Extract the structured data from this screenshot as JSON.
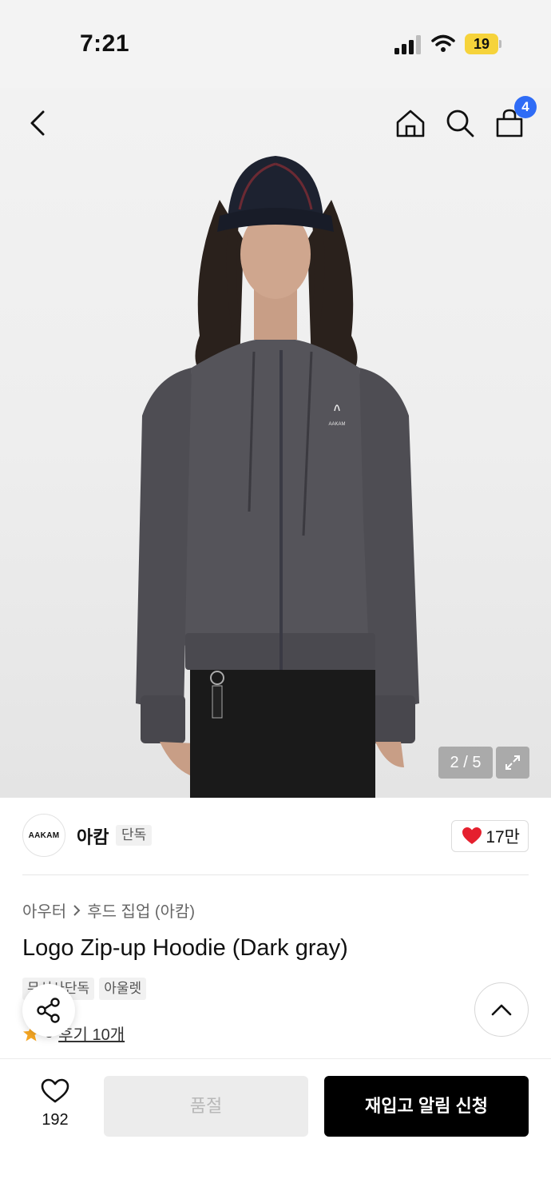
{
  "status_bar": {
    "time": "7:21",
    "battery": "19",
    "icons": [
      "cellular-signal-icon",
      "wifi-icon",
      "battery-icon"
    ]
  },
  "nav": {
    "icons": [
      "back-icon",
      "home-icon",
      "search-icon",
      "cart-icon"
    ],
    "cart_count": "4"
  },
  "gallery": {
    "counter": "2 / 5",
    "garment_logo": "AAKAM",
    "expand_icon": "expand-icon"
  },
  "brand": {
    "logo_text": "AAKAM",
    "name": "아캄",
    "tag": "단독",
    "likes": "17만"
  },
  "product": {
    "breadcrumb": [
      "아우터",
      "후드 집업 (아캄)"
    ],
    "title": "Logo Zip-up Hoodie (Dark gray)",
    "tags": [
      "무신사단독",
      "아울렛"
    ],
    "rating": "5",
    "reviews": "후기 10개"
  },
  "bottom_bar": {
    "wish_count": "192",
    "soldout_label": "품절",
    "restock_label": "재입고 알림 신청"
  },
  "colors": {
    "accent": "#2f6cf6",
    "heart": "#e5202e",
    "star": "#f5a623",
    "battery": "#f6d33b",
    "hoodie": "#55545a"
  }
}
